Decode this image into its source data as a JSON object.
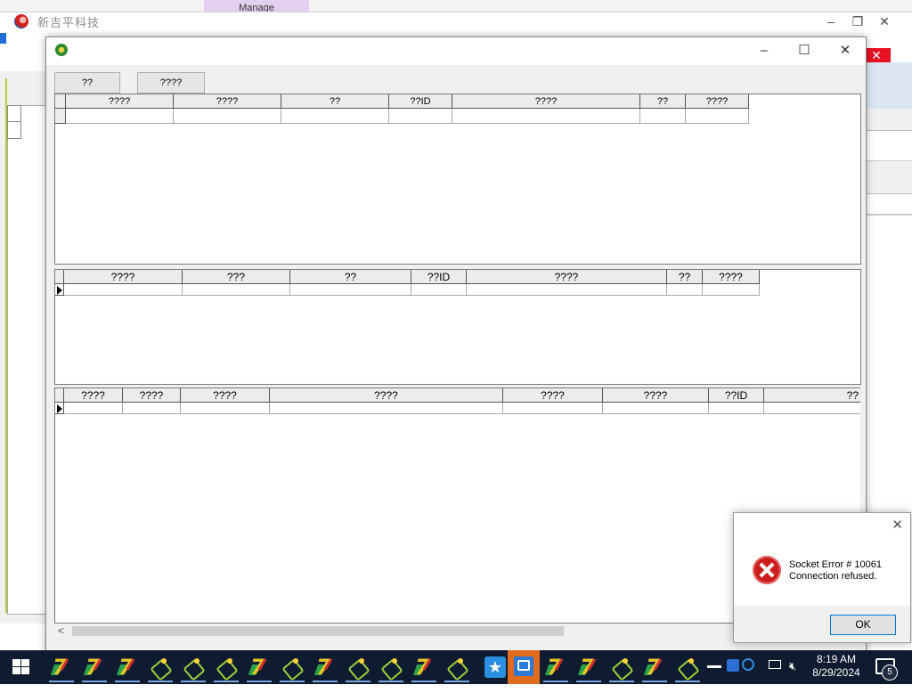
{
  "background_app": {
    "tab_label": "Manage",
    "title": "新吉平科技"
  },
  "main_window": {
    "toolbar": {
      "button1_label": "??",
      "button2_label": "????"
    },
    "grid1": {
      "columns": [
        "????",
        "????",
        "??",
        "??ID",
        "????",
        "??",
        "????"
      ]
    },
    "grid2": {
      "columns": [
        "????",
        "???",
        "??",
        "??ID",
        "????",
        "??",
        "????"
      ]
    },
    "grid3": {
      "columns": [
        "????",
        "????",
        "????",
        "????",
        "????",
        "????",
        "??ID",
        "??"
      ]
    }
  },
  "error_dialog": {
    "line1": "Socket Error # 10061",
    "line2": "Connection refused.",
    "ok_label": "OK",
    "icon": "error-icon"
  },
  "taskbar": {
    "time": "8:19 AM",
    "date": "8/29/2024",
    "notification_count": "5",
    "apps": [
      "seven",
      "seven",
      "seven",
      "apple",
      "apple",
      "apple",
      "seven",
      "apple",
      "seven",
      "apple",
      "apple",
      "seven",
      "apple",
      "star",
      "active",
      "seven",
      "seven",
      "apple",
      "seven",
      "apple"
    ]
  }
}
